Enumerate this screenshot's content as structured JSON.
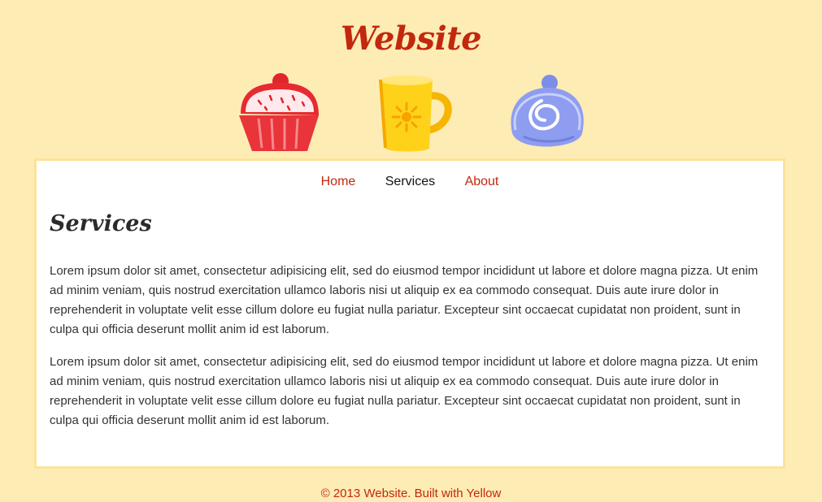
{
  "header": {
    "site_title": "Website",
    "images": [
      {
        "icon": "cupcake-icon"
      },
      {
        "icon": "mug-icon"
      },
      {
        "icon": "cake-roll-icon"
      }
    ]
  },
  "nav": {
    "items": [
      {
        "label": "Home",
        "active": false
      },
      {
        "label": "Services",
        "active": true
      },
      {
        "label": "About",
        "active": false
      }
    ]
  },
  "main": {
    "heading": "Services",
    "paragraphs": [
      "Lorem ipsum dolor sit amet, consectetur adipisicing elit, sed do eiusmod tempor incididunt ut labore et dolore magna pizza. Ut enim ad minim veniam, quis nostrud exercitation ullamco laboris nisi ut aliquip ex ea commodo consequat. Duis aute irure dolor in reprehenderit in voluptate velit esse cillum dolore eu fugiat nulla pariatur. Excepteur sint occaecat cupidatat non proident, sunt in culpa qui officia deserunt mollit anim id est laborum.",
      "Lorem ipsum dolor sit amet, consectetur adipisicing elit, sed do eiusmod tempor incididunt ut labore et dolore magna pizza. Ut enim ad minim veniam, quis nostrud exercitation ullamco laboris nisi ut aliquip ex ea commodo consequat. Duis aute irure dolor in reprehenderit in voluptate velit esse cillum dolore eu fugiat nulla pariatur. Excepteur sint occaecat cupidatat non proident, sunt in culpa qui officia deserunt mollit anim id est laborum."
    ]
  },
  "footer": {
    "text": "© 2013 Website. Built with Yellow"
  },
  "colors": {
    "background": "#feecb5",
    "accent": "#c2280e",
    "content_background": "#ffffff",
    "content_border": "#fde29a"
  }
}
